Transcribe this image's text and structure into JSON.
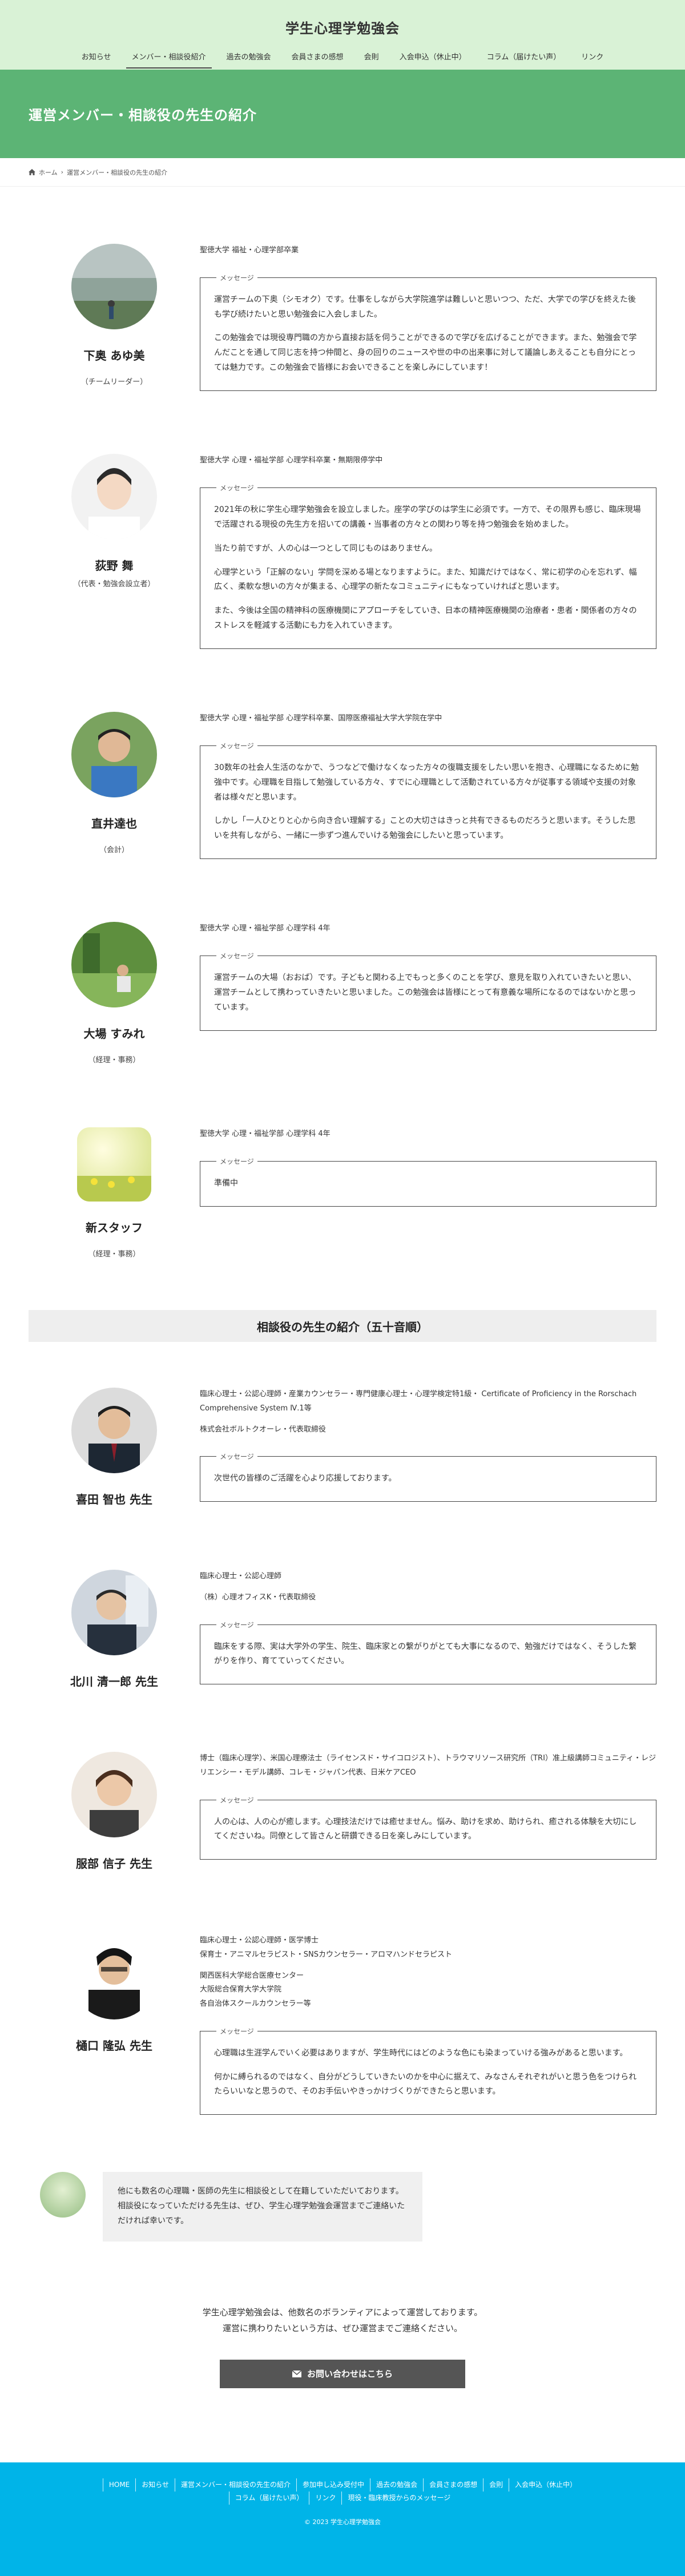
{
  "site": {
    "title": "学生心理学勉強会"
  },
  "nav": [
    "お知らせ",
    "メンバー・相談役紹介",
    "過去の勉強会",
    "会員さまの感想",
    "会則",
    "入会申込（休止中）",
    "コラム（届けたい声）",
    "リンク"
  ],
  "page": {
    "title": "運営メンバー・相談役の先生の紹介"
  },
  "breadcrumb": {
    "home": "ホーム",
    "sep": "›",
    "current": "運営メンバー・相談役の先生の紹介"
  },
  "members": [
    {
      "name": "下奥 あゆ美",
      "role": "（チームリーダー）",
      "affiliation": [
        "聖徳大学 福祉・心理学部卒業"
      ],
      "legend": "メッセージ",
      "message": [
        "運営チームの下奥（シモオク）です。仕事をしながら大学院進学は難しいと思いつつ、ただ、大学での学びを終えた後も学び続けたいと思い勉強会に入会しました。",
        "この勉強会では現役専門職の方から直接お話を伺うことができるので学びを広げることができます。また、勉強会で学んだことを通して同じ志を持つ仲間と、身の回りのニュースや世の中の出来事に対して議論しあえることも自分にとっては魅力です。この勉強会で皆様にお会いできることを楽しみにしています！"
      ]
    },
    {
      "name": "荻野 舞",
      "role": "（代表・勉強会設立者）",
      "affiliation": [
        "聖徳大学 心理・福祉学部 心理学科卒業・無期限停学中"
      ],
      "legend": "メッセージ",
      "message": [
        "2021年の秋に学生心理学勉強会を設立しました。座学の学びのは学生に必須です。一方で、その限界も感じ、臨床現場で活躍される現役の先生方を招いての講義・当事者の方々との関わり等を持つ勉強会を始めました。",
        "当たり前ですが、人の心は一つとして同じものはありません。",
        "心理学という「正解のない」学問を深める場となりますように。また、知識だけではなく、常に初学の心を忘れず、幅広く、柔軟な想いの方々が集まる、心理学の新たなコミュニティにもなっていければと思います。",
        "また、今後は全国の精神科の医療機関にアプローチをしていき、日本の精神医療機関の治療者・患者・関係者の方々のストレスを軽減する活動にも力を入れていきます。"
      ]
    },
    {
      "name": "直井達也",
      "role": "（会計）",
      "affiliation": [
        "聖徳大学 心理・福祉学部 心理学科卒業、国際医療福祉大学大学院在学中"
      ],
      "legend": "メッセージ",
      "message": [
        "30数年の社会人生活のなかで、うつなどで働けなくなった方々の復職支援をしたい思いを抱き、心理職になるために勉強中です。心理職を目指して勉強している方々、すでに心理職として活動されている方々が従事する領域や支援の対象者は様々だと思います。",
        "しかし「一人ひとりと心から向き合い理解する」ことの大切さはきっと共有できるものだろうと思います。そうした思いを共有しながら、一緒に一歩ずつ進んでいける勉強会にしたいと思っています。"
      ]
    },
    {
      "name": "大場 すみれ",
      "role": "（経理・事務）",
      "affiliation": [
        "聖徳大学 心理・福祉学部 心理学科 4年"
      ],
      "legend": "メッセージ",
      "message": [
        "運営チームの大場（おおば）です。子どもと関わる上でもっと多くのことを学び、意見を取り入れていきたいと思い、運営チームとして携わっていきたいと思いました。この勉強会は皆様にとって有意義な場所になるのではないかと思っています。"
      ]
    },
    {
      "name": "新スタッフ",
      "role": "（経理・事務）",
      "affiliation": [
        "聖徳大学 心理・福祉学部 心理学科 4年"
      ],
      "legend": "メッセージ",
      "message": [
        "準備中"
      ]
    }
  ],
  "advisors_heading": "相談役の先生の紹介（五十音順）",
  "advisors": [
    {
      "name": "喜田 智也 先生",
      "affiliation": [
        "臨床心理士・公認心理師・産業カウンセラー・専門健康心理士・心理学検定特1級・ Certificate of Proficiency in the Rorschach Comprehensive System Ⅳ.1等",
        "株式会社ボルトクオーレ・代表取締役"
      ],
      "legend": "メッセージ",
      "message": [
        "次世代の皆様のご活躍を心より応援しております。"
      ]
    },
    {
      "name": "北川 清一郎 先生",
      "affiliation": [
        "臨床心理士・公認心理師",
        "（株）心理オフィスK・代表取締役"
      ],
      "legend": "メッセージ",
      "message": [
        "臨床をする際、実は大学外の学生、院生、臨床家との繋がりがとても大事になるので、勉強だけではなく、そうした繋がりを作り、育てていってください。"
      ]
    },
    {
      "name": "服部 信子 先生",
      "affiliation": [
        "博士（臨床心理学）、米国心理療法士（ライセンスド・サイコロジスト）、トラウマリソース研究所（TRI）准上級講師コミュニティ・レジリエンシー・モデル講師、コレモ・ジャパン代表、日米ケアCEO"
      ],
      "legend": "メッセージ",
      "message": [
        "人の心は、人の心が癒します。心理技法だけでは癒せません。悩み、助けを求め、助けられ、癒される体験を大切にしてくださいね。同僚として皆さんと研鑽できる日を楽しみにしています。"
      ]
    },
    {
      "name": "樋口 隆弘 先生",
      "affiliation": [
        "臨床心理士・公認心理師・医学博士\n保育士・アニマルセラピスト・SNSカウンセラー・アロマハンドセラピスト",
        "関西医科大学総合医療センター\n大阪総合保育大学大学院\n各自治体スクールカウンセラー等"
      ],
      "legend": "メッセージ",
      "message": [
        "心理職は生涯学んでいく必要はありますが、学生時代にはどのような色にも染まっていける強みがあると思います。",
        "何かに縛られるのではなく、自分がどうしていきたいのかを中心に据えて、みなさんそれぞれがいと思う色をつけられたらいいなと思うので、そのお手伝いやきっかけづくりができたらと思います。"
      ]
    }
  ],
  "closing_speech": "他にも数名の心理職・医師の先生に相談役として在籍していただいております。\n相談役になっていただける先生は、ぜひ、学生心理学勉強会運営までご連絡いただければ幸いです。",
  "closing_text": [
    "学生心理学勉強会は、他数名のボランティアによって運営しております。",
    "運営に携わりたいという方は、ぜひ運営までご連絡ください。"
  ],
  "contact_button": "お問い合わせはこちら",
  "footer": {
    "links": [
      "HOME",
      "お知らせ",
      "運営メンバー・相談役の先生の紹介",
      "参加申し込み受付中",
      "過去の勉強会",
      "会員さまの感想",
      "会則",
      "入会申込（休止中）",
      "コラム（届けたい声）",
      "リンク",
      "現役・臨床教授からのメッセージ"
    ],
    "copyright": "© 2023 学生心理学勉強会"
  },
  "colors": {
    "header_bg": "#d9f2d6",
    "title_band": "#5cb475",
    "footer_bg": "#00b4e8",
    "button_bg": "#555555"
  },
  "icons": {
    "breadcrumb_home": "home-icon",
    "contact": "mail-icon"
  }
}
